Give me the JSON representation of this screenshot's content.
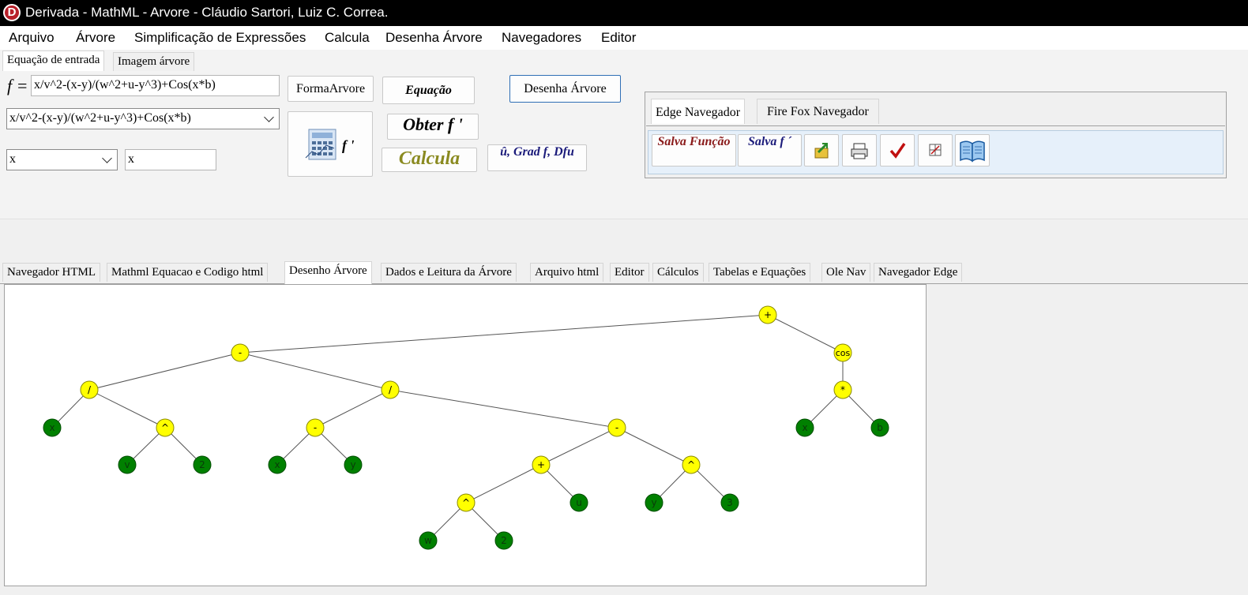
{
  "window": {
    "title": "Derivada - MathML - Arvore - Cláudio Sartori, Luiz C. Correa.",
    "icon_letter": "D"
  },
  "menu": [
    "Arquivo",
    "Árvore",
    "Simplificação de Expressões",
    "Calcula",
    "Desenha Árvore",
    "Navegadores",
    "Editor"
  ],
  "top_tabs": [
    "Equação de entrada",
    "Imagem árvore"
  ],
  "input": {
    "f_label": "f =",
    "expression": "x/v^2-(x-y)/(w^2+u-y^3)+Cos(x*b)",
    "history_combo": "x/v^2-(x-y)/(w^2+u-y^3)+Cos(x*b)",
    "variable_combo": "x",
    "variable_text": "x"
  },
  "buttons": {
    "forma_arvore": "FormaArvore",
    "equacao": "Equação",
    "desenha_arvore": "Desenha Árvore",
    "obter_f": "Obter f '",
    "calcula": "Calcula",
    "grad": "û, Grad f, Dfu",
    "derivative_icon_label": "f '"
  },
  "navigator": {
    "tabs": [
      "Edge Navegador",
      "Fire Fox Navegador"
    ],
    "salva_funcao": "Salva Função",
    "salva_f": "Salva f ´",
    "icons": [
      "export-icon",
      "print-icon",
      "check-icon",
      "grid-icon",
      "book-icon"
    ]
  },
  "bottom_tabs": [
    "Navegador HTML",
    "Mathml Equacao e Codigo html",
    "Desenho Árvore",
    "Dados e Leitura da Árvore",
    "Arquivo html",
    "Editor",
    "Cálculos",
    "Tabelas e Equações",
    "Ole Nav",
    "Navegador Edge"
  ],
  "active_bottom_tab": "Desenho Árvore",
  "tree": {
    "colors": {
      "operator": "#ffff00",
      "leaf": "#008000"
    },
    "nodes": [
      {
        "id": "n0",
        "label": "+",
        "kind": "operator"
      },
      {
        "id": "n1",
        "label": "-",
        "kind": "operator"
      },
      {
        "id": "n2",
        "label": "cos",
        "kind": "operator"
      },
      {
        "id": "n3",
        "label": "/",
        "kind": "operator"
      },
      {
        "id": "n4",
        "label": "/",
        "kind": "operator"
      },
      {
        "id": "n5",
        "label": "*",
        "kind": "operator"
      },
      {
        "id": "n6",
        "label": "x",
        "kind": "leaf"
      },
      {
        "id": "n7",
        "label": "^",
        "kind": "operator"
      },
      {
        "id": "n8",
        "label": "-",
        "kind": "operator"
      },
      {
        "id": "n9",
        "label": "-",
        "kind": "operator"
      },
      {
        "id": "n10",
        "label": "x",
        "kind": "leaf"
      },
      {
        "id": "n11",
        "label": "b",
        "kind": "leaf"
      },
      {
        "id": "n12",
        "label": "v",
        "kind": "leaf"
      },
      {
        "id": "n13",
        "label": "2",
        "kind": "leaf"
      },
      {
        "id": "n14",
        "label": "x",
        "kind": "leaf"
      },
      {
        "id": "n15",
        "label": "y",
        "kind": "leaf"
      },
      {
        "id": "n16",
        "label": "+",
        "kind": "operator"
      },
      {
        "id": "n17",
        "label": "^",
        "kind": "operator"
      },
      {
        "id": "n18",
        "label": "^",
        "kind": "operator"
      },
      {
        "id": "n19",
        "label": "u",
        "kind": "leaf"
      },
      {
        "id": "n20",
        "label": "y",
        "kind": "leaf"
      },
      {
        "id": "n21",
        "label": "3",
        "kind": "leaf"
      },
      {
        "id": "n22",
        "label": "w",
        "kind": "leaf"
      },
      {
        "id": "n23",
        "label": "2",
        "kind": "leaf"
      }
    ],
    "edges": [
      [
        "n0",
        "n1"
      ],
      [
        "n0",
        "n2"
      ],
      [
        "n1",
        "n3"
      ],
      [
        "n1",
        "n4"
      ],
      [
        "n2",
        "n5"
      ],
      [
        "n3",
        "n6"
      ],
      [
        "n3",
        "n7"
      ],
      [
        "n4",
        "n8"
      ],
      [
        "n4",
        "n9"
      ],
      [
        "n5",
        "n10"
      ],
      [
        "n5",
        "n11"
      ],
      [
        "n7",
        "n12"
      ],
      [
        "n7",
        "n13"
      ],
      [
        "n8",
        "n14"
      ],
      [
        "n8",
        "n15"
      ],
      [
        "n9",
        "n16"
      ],
      [
        "n9",
        "n17"
      ],
      [
        "n16",
        "n18"
      ],
      [
        "n16",
        "n19"
      ],
      [
        "n17",
        "n20"
      ],
      [
        "n17",
        "n21"
      ],
      [
        "n18",
        "n22"
      ],
      [
        "n18",
        "n23"
      ]
    ]
  }
}
